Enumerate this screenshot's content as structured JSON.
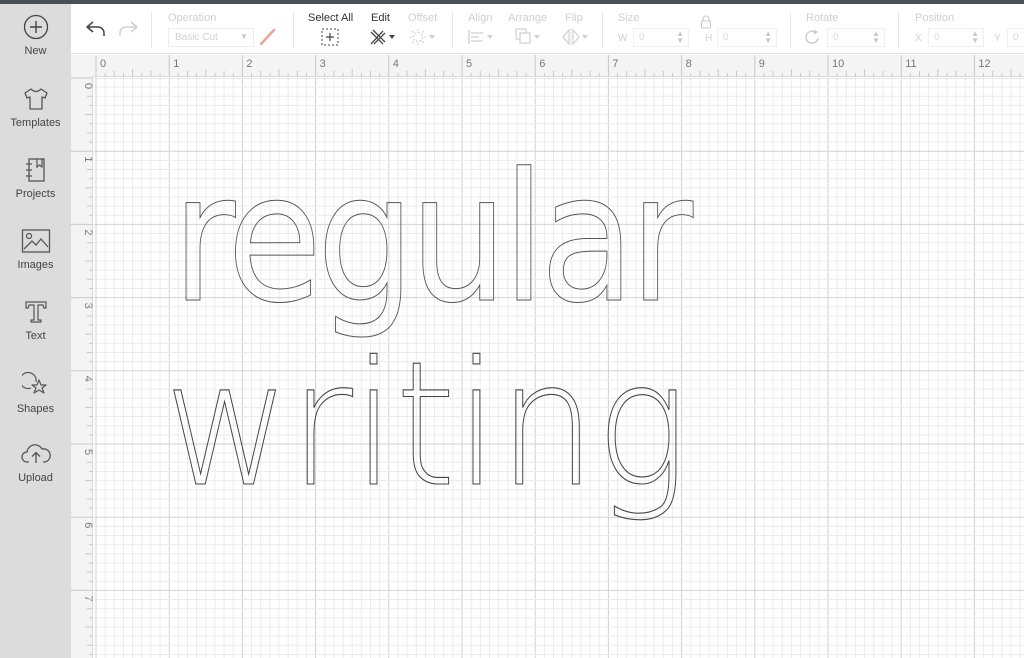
{
  "sidebar": {
    "items": [
      {
        "label": "New",
        "icon": "plus-circle-icon"
      },
      {
        "label": "Templates",
        "icon": "tshirt-icon"
      },
      {
        "label": "Projects",
        "icon": "notebook-icon"
      },
      {
        "label": "Images",
        "icon": "image-icon"
      },
      {
        "label": "Text",
        "icon": "text-t-icon"
      },
      {
        "label": "Shapes",
        "icon": "shapes-icon"
      },
      {
        "label": "Upload",
        "icon": "cloud-upload-icon"
      }
    ]
  },
  "toolbar": {
    "undo_icon": "undo-icon",
    "redo_icon": "redo-icon",
    "operation": {
      "label": "Operation",
      "value": "Basic Cut"
    },
    "select_all": "Select All",
    "edit": "Edit",
    "offset": "Offset",
    "align": "Align",
    "arrange": "Arrange",
    "flip": "Flip",
    "size": {
      "label": "Size",
      "w_label": "W",
      "w_value": "0",
      "h_label": "H",
      "h_value": "0"
    },
    "rotate": {
      "label": "Rotate",
      "value": "0"
    },
    "position": {
      "label": "Position",
      "x_label": "X",
      "x_value": "0",
      "y_label": "Y",
      "y_value": "0"
    }
  },
  "rulers": {
    "top": [
      "0",
      "1",
      "2",
      "3",
      "4",
      "5",
      "6",
      "7",
      "8",
      "9",
      "10",
      "11",
      "12"
    ],
    "left": [
      "0",
      "1",
      "2",
      "3",
      "4",
      "5",
      "6",
      "7"
    ]
  },
  "canvas": {
    "text_objects": [
      {
        "text": "regular",
        "style": "outline-bold"
      },
      {
        "text": "writing",
        "style": "single-line"
      }
    ]
  },
  "colors": {
    "topbar": "#4b4e53",
    "sidebar": "#dcdcdc",
    "pen_accent": "#e8a593",
    "outline": "#555555"
  }
}
